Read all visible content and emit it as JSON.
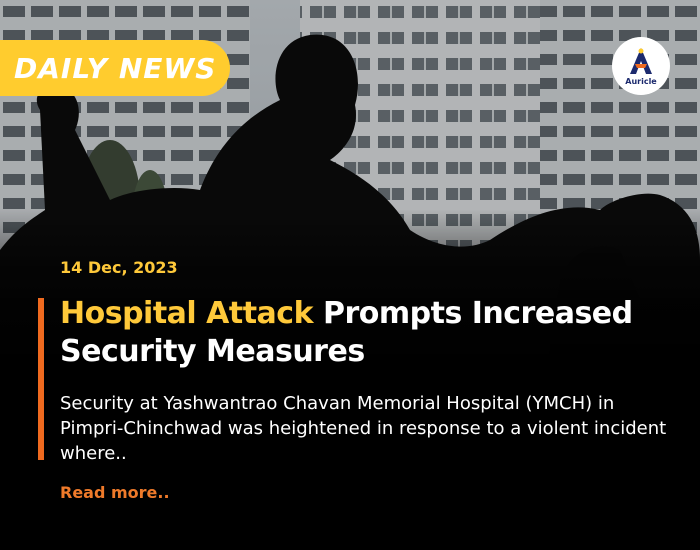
{
  "badge": {
    "label": "DAILY NEWS"
  },
  "logo": {
    "name": "Auricle"
  },
  "article": {
    "date": "14 Dec, 2023",
    "headline_highlight": "Hospital Attack",
    "headline_rest": "Prompts Increased Security Measures",
    "summary": "Security at Yashwantrao Chavan Memorial Hospital (YMCH) in Pimpri-Chinchwad was heightened in response to a violent incident where..",
    "read_more": "Read more.."
  },
  "colors": {
    "badge": "#ffcc2e",
    "highlight": "#ffc93a",
    "accent": "#ef6a1f",
    "read_more": "#ef7a2a",
    "background": "#0b0b0b"
  }
}
